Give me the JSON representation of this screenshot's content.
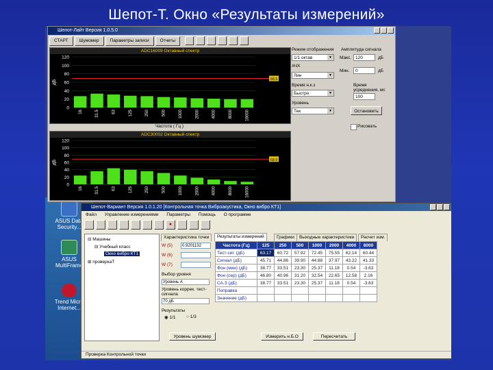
{
  "slide": {
    "title": "Шепот-Т. Окно «Результаты измерений»"
  },
  "desktop": {
    "icons": [
      {
        "label": "ASUS Data Security...",
        "icon": "shield-icon"
      },
      {
        "label": "ASUS MultiFrame",
        "icon": "multiframe-icon"
      },
      {
        "label": "Trend Micro Internet...",
        "icon": "trend-micro-icon"
      }
    ]
  },
  "top_window": {
    "title": "Шепот-Лайт  Версия 1.0.5.0",
    "toolbar": [
      "СТАРТ",
      "Шумомер",
      "Параметры записи",
      "Отчеты"
    ],
    "chart1": {
      "header": "ADC16009  Октавный спектр",
      "footer": "Частота ( Гц )",
      "level_label": "68.9"
    },
    "chart2": {
      "header": "ADC30002  Октавный спектр",
      "footer": "Частота ( Гц )",
      "level_label": "68.9"
    },
    "panel": {
      "mode_label": "Режим отображения",
      "mode_value": "1/1 октав",
      "ampl_label": "Амплитуда сигнала",
      "max_label": "Макс.",
      "max_value": "120",
      "max_unit": "дБ",
      "min_label": "Мин.",
      "min_value": "0",
      "min_unit": "дБ",
      "afc_label": "АЧХ",
      "afc_value": "Лин",
      "avg_label": "Время усреднения, мс",
      "avg_value": "100",
      "time_label": "Время н.к.з",
      "time_value": "Быстро",
      "level_label": "Уровень",
      "level_value": "Тек",
      "stop_button": "Остановить",
      "checkbox_label": "Рисовать"
    }
  },
  "chart_data": [
    {
      "type": "bar",
      "title": "ADC16009  Октавный спектр",
      "xlabel": "Частота ( Гц )",
      "ylabel": "дБ",
      "categories": [
        "16",
        "31.5",
        "63",
        "125",
        "250",
        "500",
        "1000",
        "2000",
        "4000",
        "8000",
        "16000"
      ],
      "values": [
        27,
        33,
        31,
        28,
        27,
        25,
        24,
        22,
        21,
        20,
        20
      ],
      "ylim": [
        0,
        120
      ],
      "yticks": [
        0,
        20,
        40,
        60,
        80,
        100,
        120
      ],
      "threshold": 68.9,
      "bar_color": "#4ee01a",
      "grid": true
    },
    {
      "type": "bar",
      "title": "ADC30002  Октавный спектр",
      "xlabel": "Частота ( Гц )",
      "ylabel": "дБ",
      "categories": [
        "16",
        "31.5",
        "63",
        "125",
        "250",
        "500",
        "1000",
        "2000",
        "4000",
        "8000",
        "16000"
      ],
      "values": [
        24,
        36,
        44,
        40,
        36,
        31,
        24,
        18,
        13,
        9,
        7
      ],
      "ylim": [
        0,
        120
      ],
      "yticks": [
        0,
        20,
        40,
        60,
        80,
        100,
        120
      ],
      "threshold": 68.9,
      "bar_color": "#4ee01a",
      "grid": true
    }
  ],
  "bottom_window": {
    "title": "Шепот-Вариант   Версия 1.0.1.20  [Контрольная точка Виброакустика, Окно вибро КТ1]",
    "menu": [
      "Файл",
      "Управление измерениями",
      "Параметры",
      "Помощь",
      "О программе"
    ],
    "tree": [
      {
        "text": "Машины"
      },
      {
        "text": "Учебный класс"
      },
      {
        "text": "Окно вибро КТ1"
      },
      {
        "text": "проверкаТ"
      }
    ],
    "tabs": [
      "Характеристика точки",
      "Результаты измерений",
      "Графики",
      "Выходные характеристики",
      "Расчет изм."
    ],
    "active_tab": 1,
    "controls": {
      "w5_label": "W (5)",
      "w5_value": "0.9201132",
      "w6_label": "W (6)",
      "w7_label": "W (7)",
      "level_label": "Выбор уровня",
      "level_value": "Уровень A",
      "correction_label": "Уровень коррек. тест-сигнала",
      "correction_value": "70 дБ",
      "results_label": "Результаты",
      "radio1": "1/1",
      "radio2": "1/3"
    },
    "table": {
      "header": [
        "Частота (Гц)",
        "125",
        "250",
        "500",
        "1000",
        "2000",
        "4000",
        "8000"
      ],
      "rows": [
        {
          "label": "Тест-сиг. (дБ)",
          "values": [
            "63.17",
            "60.72",
            "57.92",
            "72.45",
            "75.55",
            "62.14",
            "60.44"
          ]
        },
        {
          "label": "Сигнал (дБ)",
          "values": [
            "45.71",
            "44.86",
            "39.90",
            "44.88",
            "37.97",
            "43.22",
            "41.33"
          ]
        },
        {
          "label": "Фон (мин) (дБ)",
          "values": [
            "38.77",
            "33.51",
            "23.30",
            "25.37",
            "11.18",
            "0.54",
            "-3.63"
          ]
        },
        {
          "label": "Фон (сер) (дБ)",
          "values": [
            "46.80",
            "40.96",
            "31.20",
            "32.54",
            "22.65",
            "12.58",
            "2.16"
          ]
        },
        {
          "label": "СА.З (дБ)",
          "values": [
            "38.77",
            "33.51",
            "23.30",
            "25.37",
            "11.18",
            "0.54",
            "-3.63"
          ]
        },
        {
          "label": "Поправка",
          "values": [
            "",
            "",
            "",
            "",
            "",
            "",
            ""
          ]
        },
        {
          "label": "Значение (дБ)",
          "values": [
            "",
            "",
            "",
            "",
            "",
            "",
            ""
          ]
        }
      ]
    },
    "buttons": {
      "measure": "Уровень шумомер",
      "change": "Измерить н.Б.О",
      "recalc": "Пересчитать"
    },
    "status": "Проверка Контрольной точки"
  }
}
